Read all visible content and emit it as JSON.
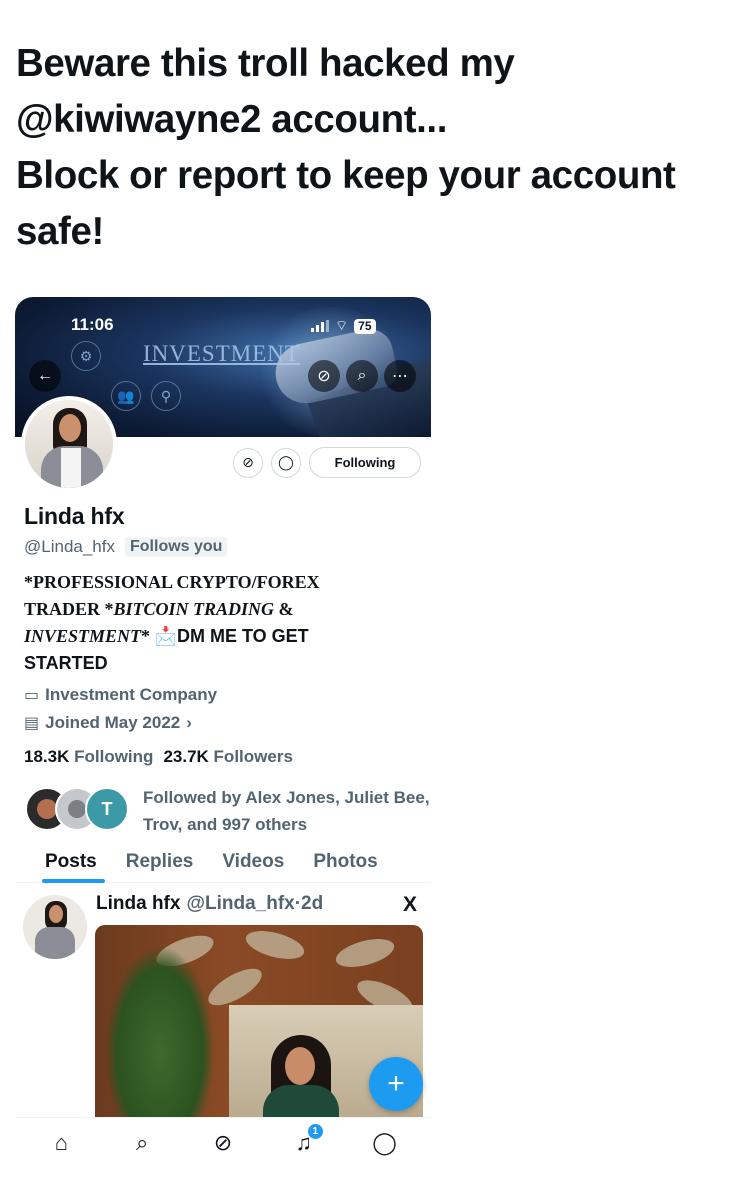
{
  "headline": {
    "line1": "Beware this troll hacked my",
    "line2": "@kiwiwayne2 account...",
    "line3": "Block or report to keep your account",
    "line4": "safe!"
  },
  "status_bar": {
    "time": "11:06",
    "battery": "75"
  },
  "banner": {
    "text": "INVESTMENT"
  },
  "profile": {
    "name": "Linda hfx",
    "handle": "@Linda_hfx",
    "follows_you": "Follows you",
    "following_button": "Following",
    "bio_part1": "*PROFESSIONAL CRYPTO/FOREX",
    "bio_part2": "TRADER *",
    "bio_part3_italic": "BITCOIN TRADING",
    "bio_part4": " &",
    "bio_part5_italic": "INVESTMENT",
    "bio_part6": "* ",
    "bio_emoji": "📩",
    "bio_part7": "DM ME TO GET",
    "bio_part8": "STARTED",
    "category": "Investment Company",
    "joined": "Joined May 2022",
    "following_count": "18.3K",
    "following_label": "Following",
    "followers_count": "23.7K",
    "followers_label": "Followers",
    "followed_by": "Followed by Alex Jones, Juliet Bee, Trov, and 997 others",
    "mini_avatar_letter": "T"
  },
  "tabs": [
    {
      "label": "Posts",
      "active": true
    },
    {
      "label": "Replies",
      "active": false
    },
    {
      "label": "Videos",
      "active": false
    },
    {
      "label": "Photos",
      "active": false
    }
  ],
  "post": {
    "author_name": "Linda hfx",
    "author_handle": "@Linda_hfx",
    "separator": "·",
    "age": "2d",
    "platform_logo": "X"
  },
  "fab": {
    "label": "+"
  },
  "bottom_nav": {
    "home_icon": "home-icon",
    "search_icon": "search-icon",
    "grok_icon": "grok-icon",
    "notifications_icon": "bell-icon",
    "notifications_badge": "1",
    "messages_icon": "messages-icon"
  },
  "colors": {
    "accent": "#1d9bf0",
    "text": "#0f1419",
    "secondary": "#536471"
  }
}
